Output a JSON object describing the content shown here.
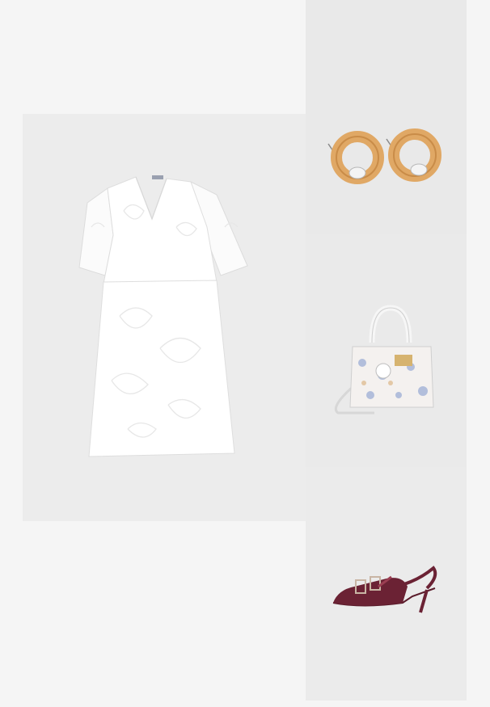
{
  "outfit": {
    "items": [
      {
        "icon": "white-lace-dress-image",
        "color": "#ffffff"
      },
      {
        "icon": "gold-hoop-earrings-image",
        "color": "#e0a865"
      },
      {
        "icon": "floral-tote-bag-image",
        "color": "#f4f1ef"
      },
      {
        "icon": "burgundy-slingback-heels-image",
        "color": "#6b2234"
      }
    ],
    "tile_colors": {
      "dress": "#ececec",
      "earrings": "#e9e9e9",
      "bag": "#eaeaea",
      "shoes": "#ebebeb"
    }
  }
}
